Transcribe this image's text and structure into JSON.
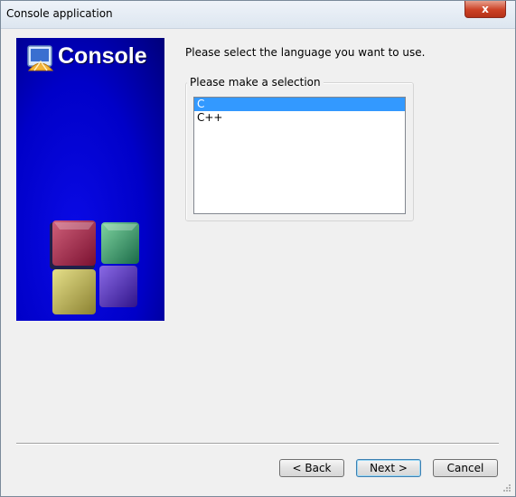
{
  "window": {
    "title": "Console application"
  },
  "banner": {
    "title": "Console"
  },
  "page": {
    "prompt": "Please select the language you want to use.",
    "group_label": "Please make a selection",
    "languages": [
      {
        "label": "C",
        "selected": true
      },
      {
        "label": "C++",
        "selected": false
      }
    ]
  },
  "buttons": {
    "back": "< Back",
    "next": "Next >",
    "cancel": "Cancel",
    "close": "x"
  },
  "colors": {
    "banner_blue": "#0000c8",
    "selection": "#3399ff",
    "close_red": "#cc4125"
  }
}
